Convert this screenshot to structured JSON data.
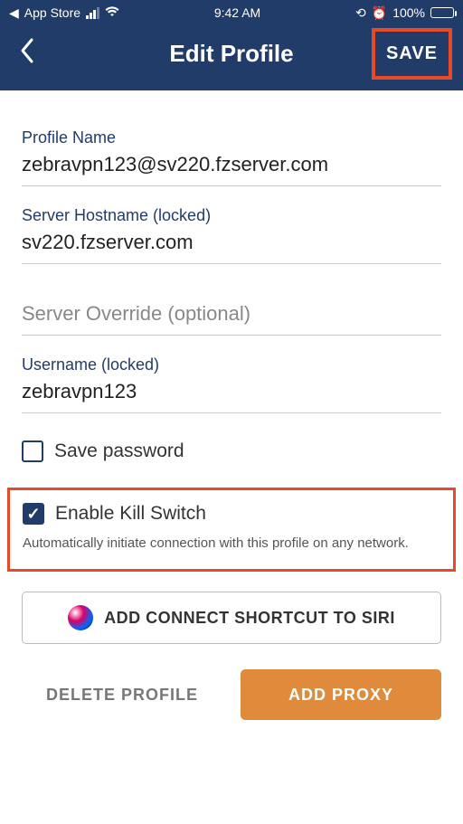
{
  "status_bar": {
    "back_app": "App Store",
    "time": "9:42 AM",
    "battery_percent": "100%"
  },
  "nav": {
    "title": "Edit Profile",
    "save_label": "SAVE"
  },
  "fields": {
    "profile_name": {
      "label": "Profile Name",
      "value": "zebravpn123@sv220.fzserver.com"
    },
    "server_hostname": {
      "label": "Server Hostname (locked)",
      "value": "sv220.fzserver.com"
    },
    "server_override": {
      "placeholder": "Server Override (optional)",
      "value": ""
    },
    "username": {
      "label": "Username (locked)",
      "value": "zebravpn123"
    }
  },
  "save_password": {
    "label": "Save password",
    "checked": false
  },
  "kill_switch": {
    "label": "Enable Kill Switch",
    "checked": true,
    "description": "Automatically initiate connection with this profile on any network."
  },
  "siri_button": "ADD CONNECT SHORTCUT TO SIRI",
  "buttons": {
    "delete": "DELETE PROFILE",
    "add_proxy": "ADD PROXY"
  }
}
